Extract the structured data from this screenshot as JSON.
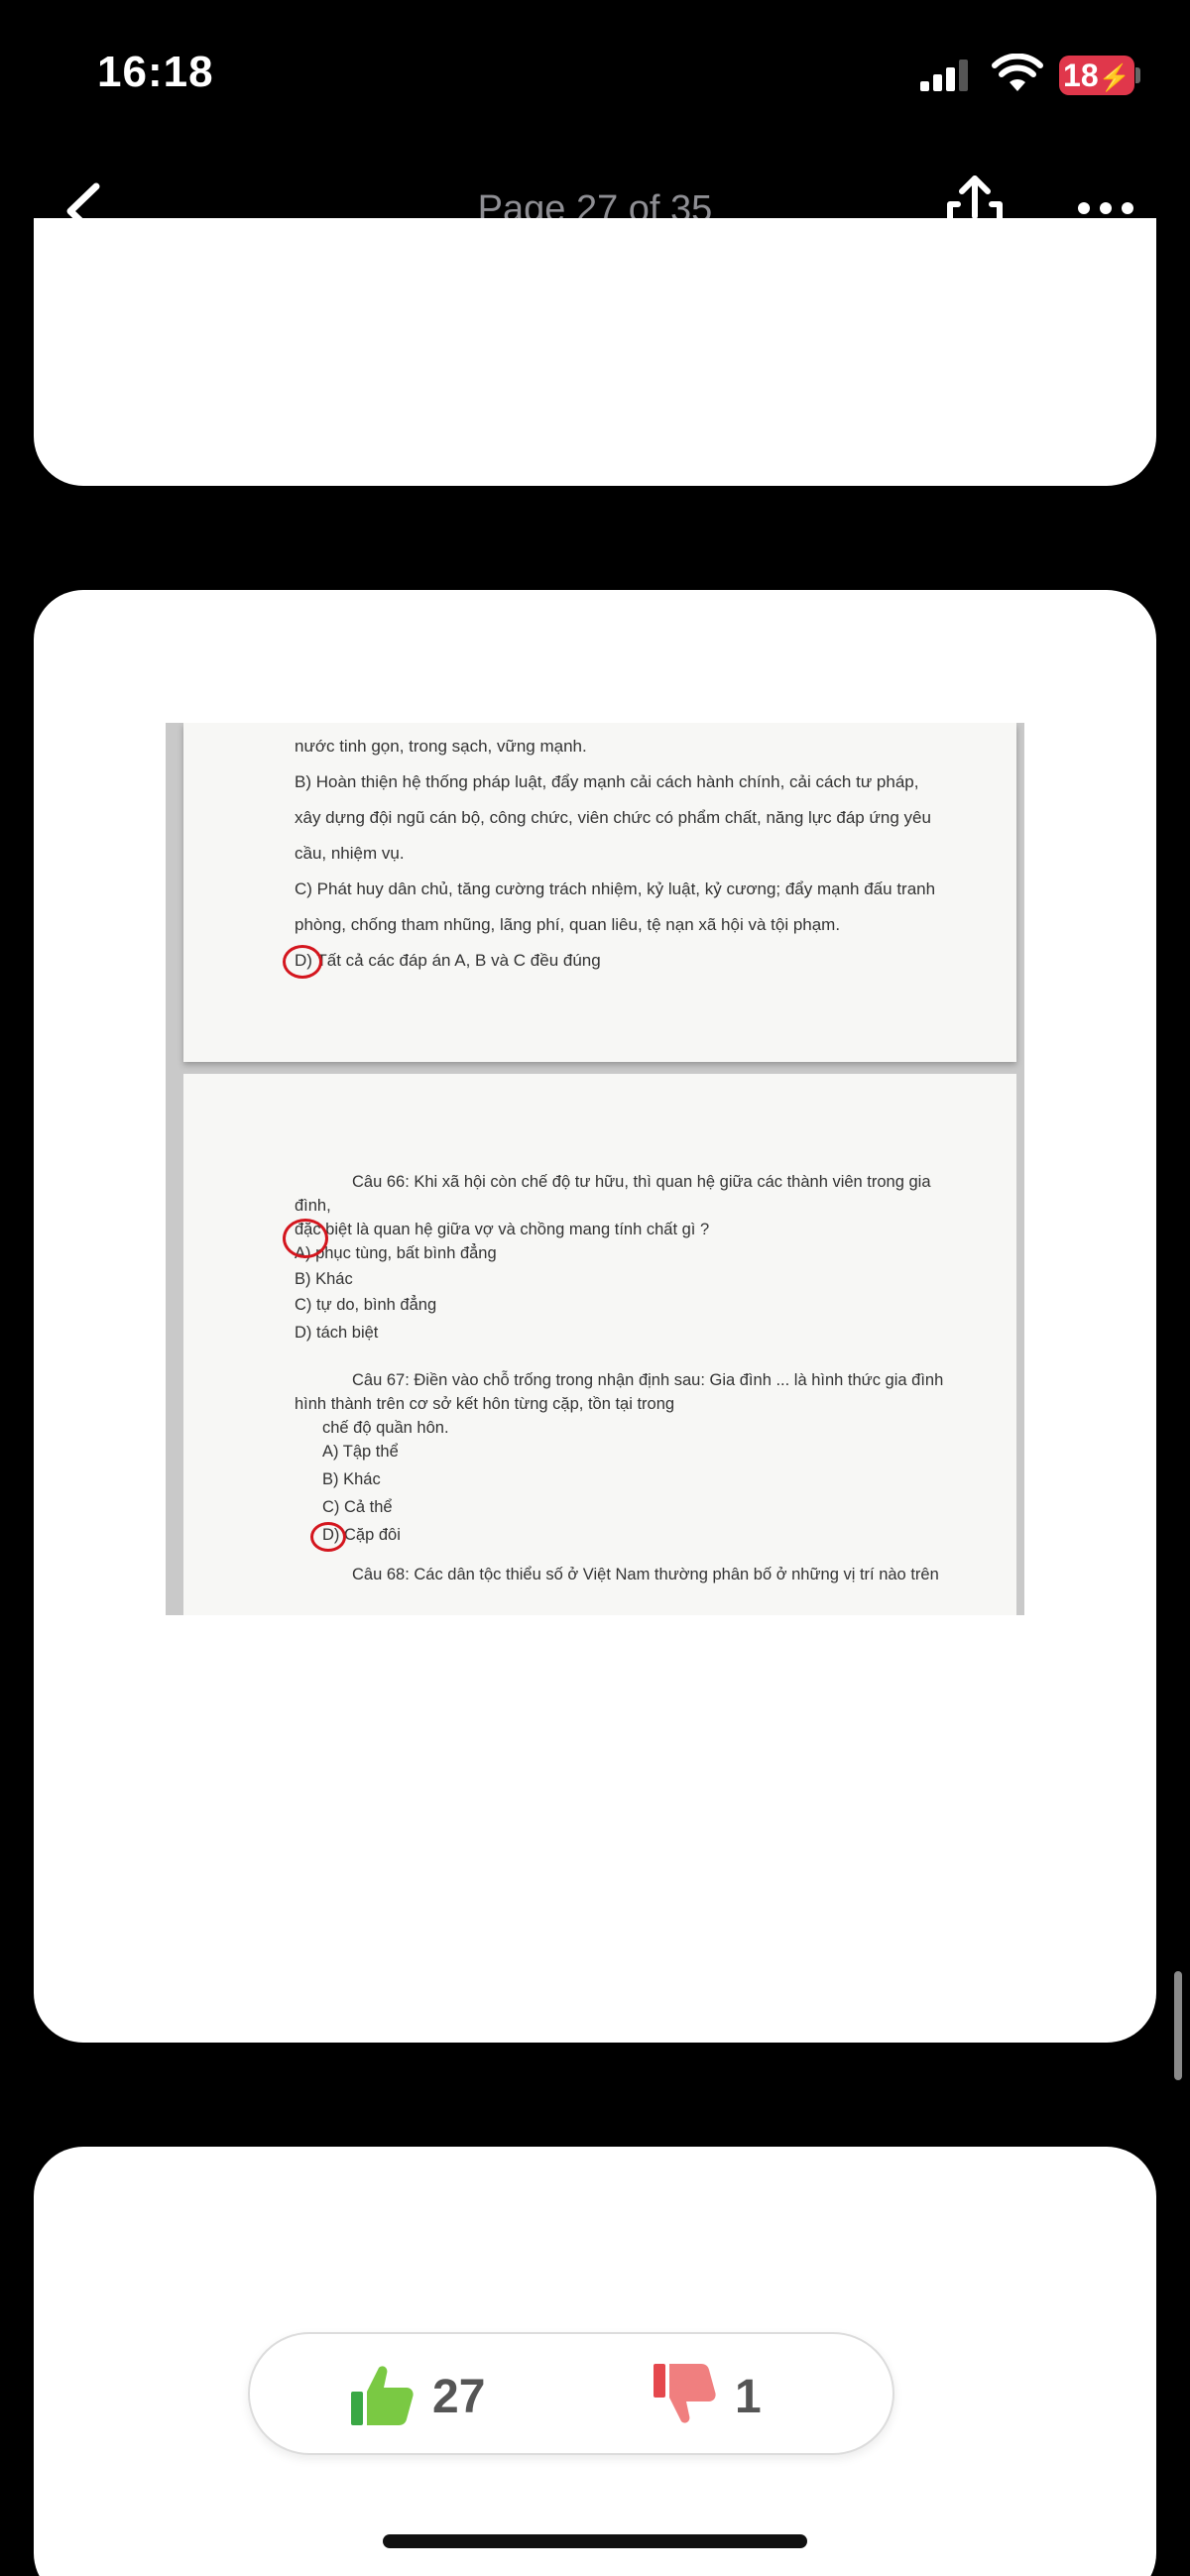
{
  "status_bar": {
    "time": "16:18",
    "battery": "18"
  },
  "nav": {
    "title": "Page 27 of 35"
  },
  "document": {
    "sheet1_lines": [
      "nước tinh gọn, trong sạch, vững mạnh.",
      "B) Hoàn thiện hệ thống pháp luật, đẩy mạnh cải cách hành chính, cải cách tư pháp,",
      "xây dựng đội ngũ cán bộ, công chức, viên chức có phẩm chất, năng lực đáp ứng yêu",
      "cầu, nhiệm vụ.",
      "C) Phát huy dân chủ, tăng cường trách nhiệm, kỷ luật, kỷ cương; đẩy mạnh đấu tranh",
      "phòng, chống tham nhũng, lãng phí, quan liêu, tệ nạn xã hội và tội phạm.",
      "D) Tất cả các đáp án A, B và C đều đúng"
    ],
    "sheet2_lines": [
      "Câu 66: Khi xã hội còn chế độ tư hữu, thì quan hệ giữa các thành viên trong gia",
      "đình,",
      "đặc biệt là quan hệ giữa vợ và chồng mang tính chất gì ?",
      "A) phục tùng, bất bình đẳng",
      "B) Khác",
      "C) tự do, bình đẳng",
      "D) tách biệt",
      "Câu 67: Điền vào chỗ trống trong nhận định sau: Gia đình ... là hình thức gia đình",
      "hình thành trên cơ sở kết hôn từng cặp, tồn tại trong",
      "chế độ quần hôn.",
      "A) Tập thể",
      "B) Khác",
      "C) Cả thể",
      "D) Cặp đôi",
      "Câu 68: Các dân tộc thiểu số ở Việt Nam thường phân bố ở những vị trí nào trên"
    ]
  },
  "votes": {
    "likes": "27",
    "dislikes": "1",
    "like_color": "#3aa845",
    "dislike_color": "#e5484d"
  }
}
